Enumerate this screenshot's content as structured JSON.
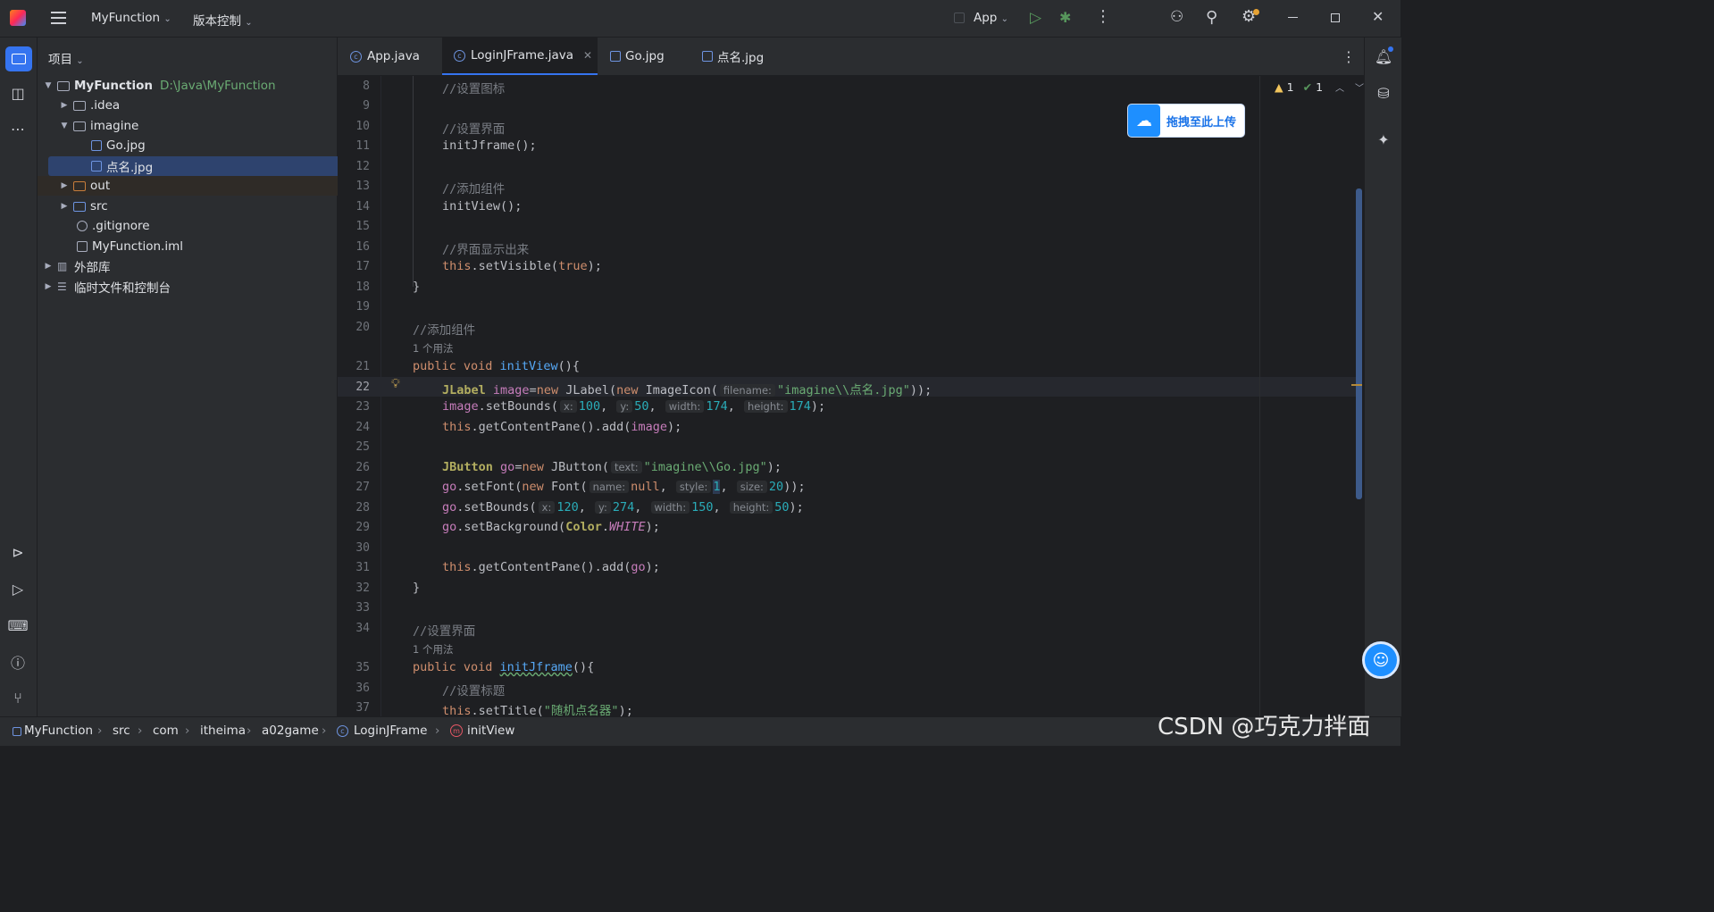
{
  "titlebar": {
    "project": "MyFunction",
    "vcs": "版本控制",
    "run_config": "App"
  },
  "project_panel": {
    "title": "项目",
    "tree": [
      {
        "name": "MyFunction",
        "path": "D:\\Java\\MyFunction"
      },
      {
        "name": ".idea"
      },
      {
        "name": "imagine"
      },
      {
        "name": "Go.jpg"
      },
      {
        "name": "点名.jpg"
      },
      {
        "name": "out"
      },
      {
        "name": "src"
      },
      {
        "name": ".gitignore"
      },
      {
        "name": "MyFunction.iml"
      },
      {
        "name": "外部库"
      },
      {
        "name": "临时文件和控制台"
      }
    ]
  },
  "tabs": [
    "App.java",
    "LoginJFrame.java",
    "Go.jpg",
    "点名.jpg"
  ],
  "inspections": {
    "warnings": "1",
    "ok": "1"
  },
  "upload_badge": "拖拽至此上传",
  "usage_hint": "1 个用法",
  "line_numbers": [
    "8",
    "9",
    "10",
    "11",
    "12",
    "13",
    "14",
    "15",
    "16",
    "17",
    "18",
    "19",
    "20",
    "21",
    "22",
    "23",
    "24",
    "25",
    "26",
    "27",
    "28",
    "29",
    "30",
    "31",
    "32",
    "33",
    "34",
    "35",
    "36",
    "37"
  ],
  "code": {
    "c8": "//设置图标",
    "c10": "//设置界面",
    "c11": "initJframe();",
    "c13": "//添加组件",
    "c14": "initView();",
    "c16": "//界面显示出来",
    "c20": "//添加组件",
    "c26_str": "\"imagine\\\\Go.jpg\"",
    "c22_str": "\"imagine\\\\点名.jpg\"",
    "c34": "//设置界面",
    "c36": "//设置标题",
    "c37_str": "\"随机点名器\""
  },
  "hints": {
    "filename": "filename:",
    "x": "x:",
    "y": "y:",
    "width": "width:",
    "height": "height:",
    "text": "text:",
    "name": "name:",
    "style": "style:",
    "size": "size:"
  },
  "breadcrumb": [
    "MyFunction",
    "src",
    "com",
    "itheima",
    "a02game",
    "LoginJFrame",
    "initView"
  ],
  "watermark": "CSDN @巧克力拌面"
}
